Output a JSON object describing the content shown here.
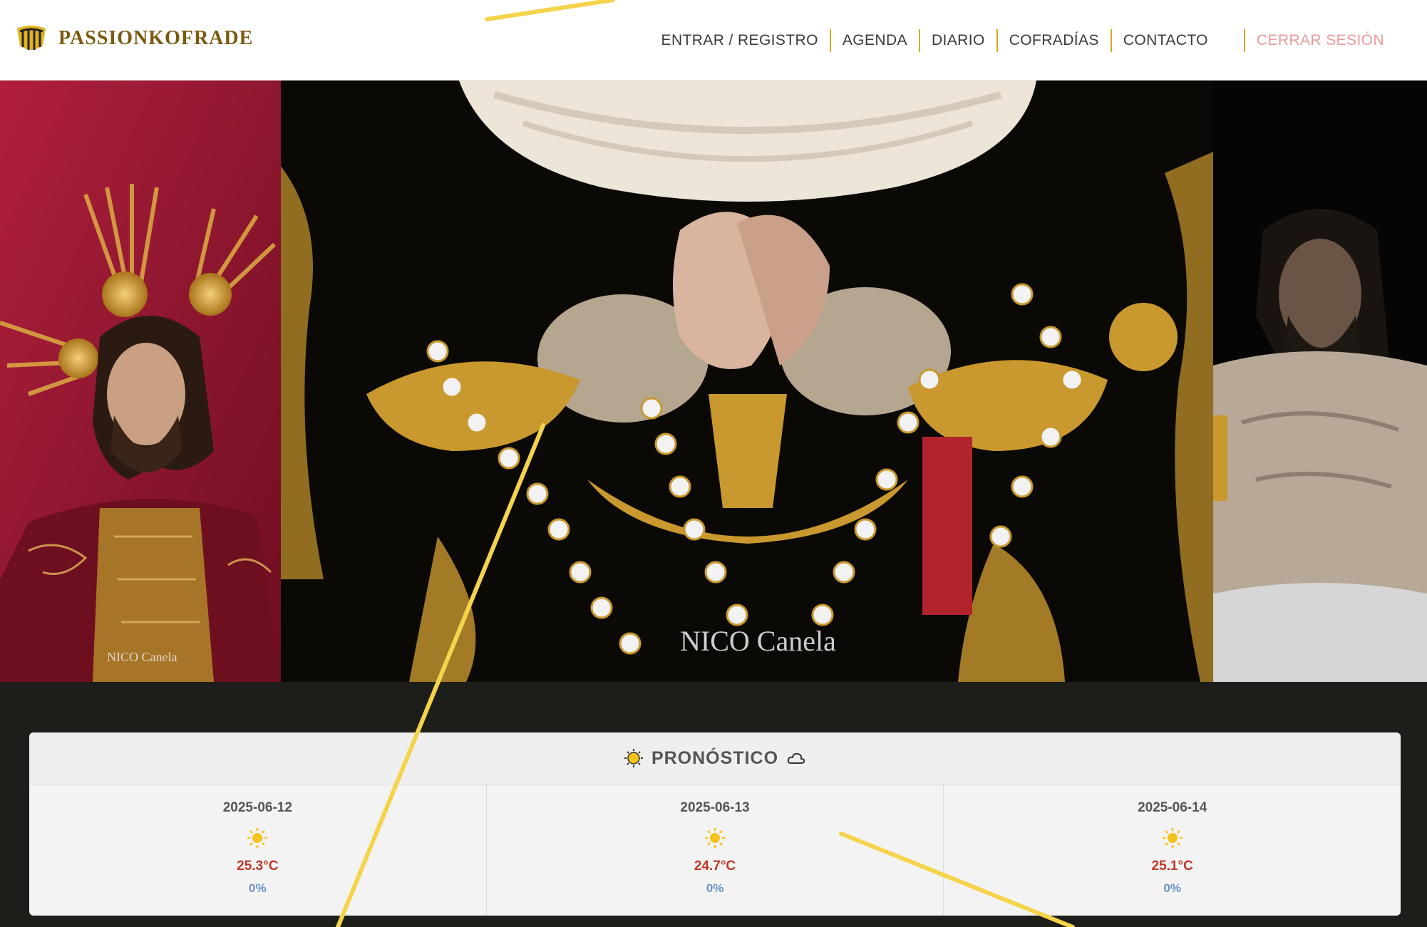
{
  "brand": {
    "name": "PASSIONKOFRADE",
    "icon": "shield-icon"
  },
  "nav": {
    "items": [
      "ENTRAR / REGISTRO",
      "AGENDA",
      "DIARIO",
      "COFRADÍAS",
      "CONTACTO"
    ],
    "logout": "CERRAR SESIÓN"
  },
  "hero": {
    "watermark_center": "NICO Canela",
    "watermark_left": "NICO Canela"
  },
  "forecast": {
    "title": "PRONÓSTICO",
    "title_icon_left": "sun-icon",
    "title_icon_right": "cloud-icon",
    "days": [
      {
        "date": "2025-06-12",
        "icon": "sun-icon",
        "temp": "25.3°C",
        "rain": "0%"
      },
      {
        "date": "2025-06-13",
        "icon": "sun-icon",
        "temp": "24.7°C",
        "rain": "0%"
      },
      {
        "date": "2025-06-14",
        "icon": "sun-icon",
        "temp": "25.1°C",
        "rain": "0%"
      }
    ]
  },
  "colors": {
    "accent_gold": "#d9a81e",
    "brand_text": "#7b5a10",
    "logout": "#e99a9a",
    "temp": "#c0392b",
    "rain": "#6a93c4",
    "page_bg": "#1d1d19",
    "annotation_line": "#f5d34a"
  }
}
